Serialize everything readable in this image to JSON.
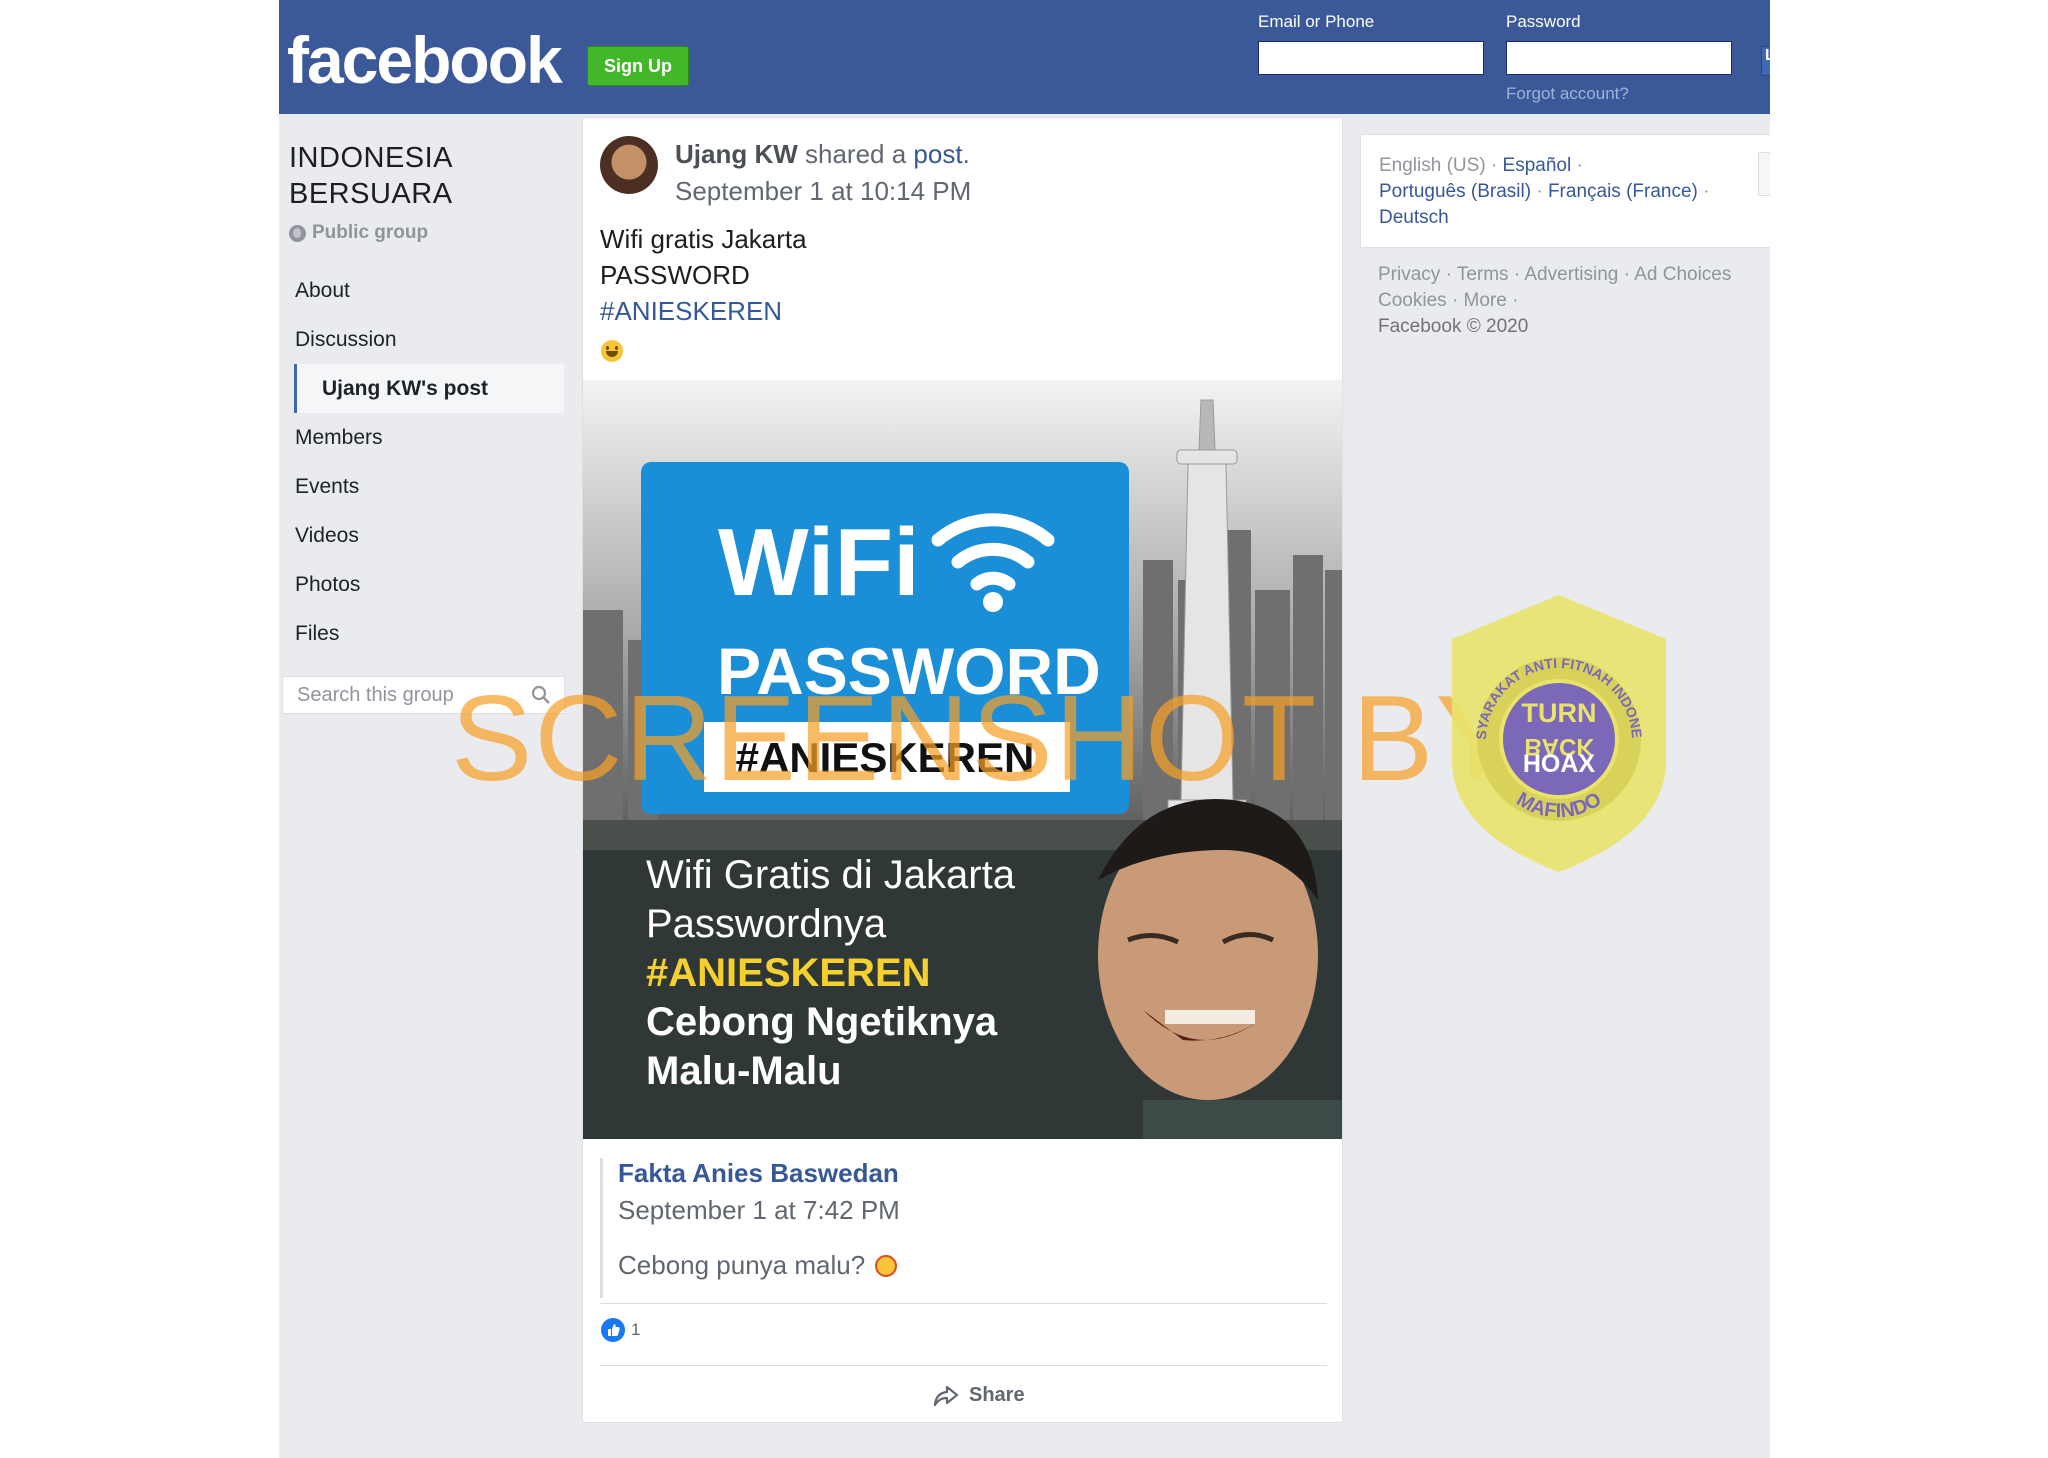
{
  "header": {
    "logo": "facebook",
    "signup_label": "Sign Up",
    "email_label": "Email or Phone",
    "password_label": "Password",
    "forgot_label": "Forgot account?",
    "login_label": "L"
  },
  "group": {
    "name": "INDONESIA BERSUARA",
    "type": "Public group",
    "nav": [
      "About",
      "Discussion",
      "Ujang KW's post",
      "Members",
      "Events",
      "Videos",
      "Photos",
      "Files"
    ],
    "active_nav": "Ujang KW's post",
    "search_placeholder": "Search this group"
  },
  "post": {
    "author": "Ujang KW",
    "action": " shared a ",
    "link": "post",
    "period": ".",
    "date": "September 1 at 10:14 PM",
    "text_line1": "Wifi gratis Jakarta",
    "text_line2": "PASSWORD",
    "hashtag": "#ANIESKEREN",
    "image": {
      "wifi": "WiFi",
      "password": "PASSWORD",
      "tag": "#ANIESKEREN",
      "line1": "Wifi Gratis di Jakarta",
      "line2": "Passwordnya",
      "line3": "#ANIESKEREN",
      "line4": "Cebong Ngetiknya",
      "line5": "Malu-Malu"
    },
    "shared": {
      "name": "Fakta Anies Baswedan",
      "date": "September 1 at 7:42 PM",
      "text": "Cebong punya malu?"
    },
    "like_count": "1",
    "share_label": "Share"
  },
  "right": {
    "lang_current": "English (US)",
    "lang_es": "Español",
    "lang_pt": "Português (Brasil)",
    "lang_fr": "Français (France)",
    "lang_de": "Deutsch",
    "footer_line1": "Privacy · Terms · Advertising · Ad Choices",
    "footer_line2": "Cookies · More ·",
    "copyright": "Facebook © 2020"
  },
  "overlay": {
    "watermark": "SCREENSHOT BY",
    "badge_turn": "TURN",
    "badge_back": "BACK",
    "badge_hoax": "HOAX",
    "badge_ring_top": "MASYARAKAT ANTI FITNAH INDONESIA",
    "badge_ring_bottom": "MAFINDO"
  },
  "colors": {
    "facebook_blue": "#3b5998",
    "signup_green": "#42b72a",
    "link_blue": "#365899",
    "page_bg": "#e9ebee",
    "watermark_orange": "#f7a028",
    "badge_yellow": "#e9e36a",
    "badge_purple": "#7b68b8"
  }
}
